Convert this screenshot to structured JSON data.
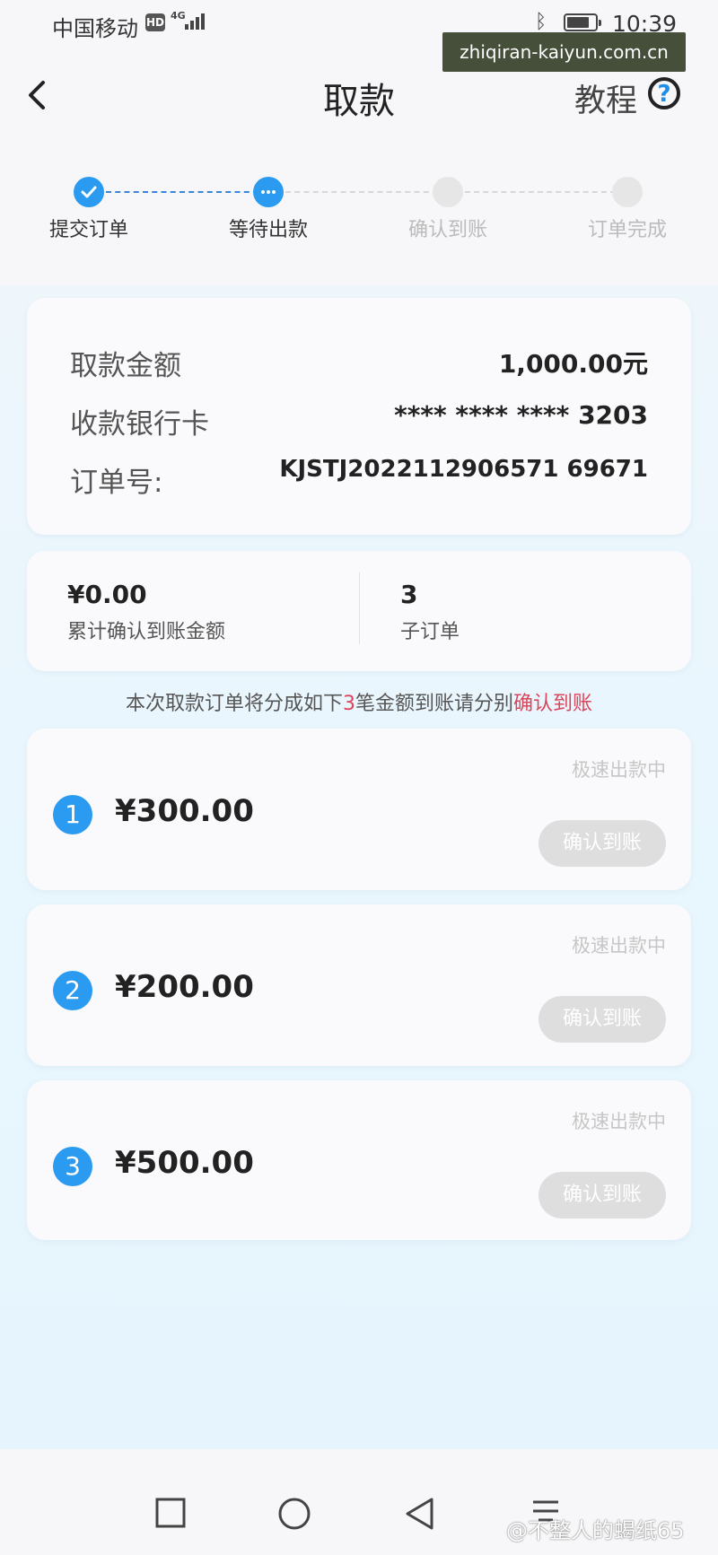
{
  "status_bar": {
    "carrier": "中国移动",
    "hd_badge": "HD",
    "network": "4G",
    "time": "10:39",
    "battery_level": 0.8
  },
  "watermark_url": "zhiqiran-kaiyun.com.cn",
  "header": {
    "title": "取款",
    "tutorial_label": "教程",
    "help_glyph": "?"
  },
  "steps": [
    {
      "label": "提交订单",
      "state": "done"
    },
    {
      "label": "等待出款",
      "state": "current"
    },
    {
      "label": "确认到账",
      "state": "pending"
    },
    {
      "label": "订单完成",
      "state": "pending"
    }
  ],
  "withdrawal": {
    "amount_label": "取款金额",
    "amount_value": "1,000.00元",
    "card_label": "收款银行卡",
    "card_value": "**** **** **** 3203",
    "order_label": "订单号:",
    "order_value": "KJSTJ2022112906571 69671"
  },
  "stats": {
    "confirmed_amount": "¥0.00",
    "confirmed_label": "累计确认到账金额",
    "sub_orders_count": "3",
    "sub_orders_label": "子订单"
  },
  "notice": {
    "prefix": "本次取款订单将分成如下",
    "count": "3",
    "middle": "笔金额到账请分别",
    "action": "确认到账"
  },
  "orders": [
    {
      "index": "1",
      "amount": "¥300.00",
      "status": "极速出款中",
      "button": "确认到账"
    },
    {
      "index": "2",
      "amount": "¥200.00",
      "status": "极速出款中",
      "button": "确认到账"
    },
    {
      "index": "3",
      "amount": "¥500.00",
      "status": "极速出款中",
      "button": "确认到账"
    }
  ],
  "footer_watermark": "@不整人的蝎纸65",
  "colors": {
    "accent": "#2a9bf0",
    "highlight": "#d9455a",
    "disabled_button": "#dedede"
  },
  "icons": [
    "back-chevron-icon",
    "help-circle-icon",
    "check-icon",
    "more-dots-icon",
    "bluetooth-icon",
    "battery-icon",
    "signal-icon",
    "square-nav-icon",
    "circle-nav-icon",
    "triangle-back-icon",
    "menu-icon"
  ]
}
